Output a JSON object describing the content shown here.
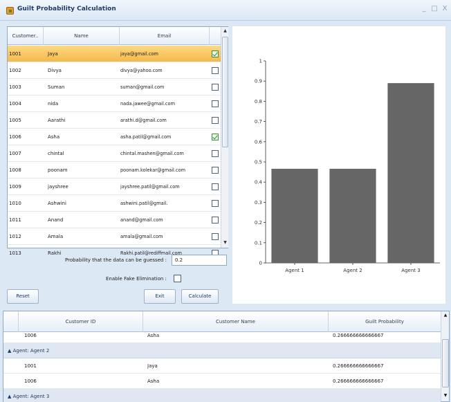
{
  "window": {
    "title": "Guilt Probability Calculation",
    "minimize": "_",
    "maximize": "□",
    "close": "X"
  },
  "grid": {
    "columns": [
      "Customer..",
      "Name",
      "Email"
    ],
    "rows": [
      {
        "id": "1001",
        "name": "Jaya",
        "email": "jaya@gmail.com",
        "checked": true,
        "selected": true
      },
      {
        "id": "1002",
        "name": "Divya",
        "email": "divya@yahoo.com",
        "checked": false
      },
      {
        "id": "1003",
        "name": "Suman",
        "email": "suman@gmail.com",
        "checked": false
      },
      {
        "id": "1004",
        "name": "nida",
        "email": "nada.jawee@gmail.com",
        "checked": false
      },
      {
        "id": "1005",
        "name": "Aarathi",
        "email": "arathi.d@gmail.com",
        "checked": false
      },
      {
        "id": "1006",
        "name": "Asha",
        "email": "asha.patil@gmail.com",
        "checked": true
      },
      {
        "id": "1007",
        "name": "chintal",
        "email": "chintal.mashen@gmail.com",
        "checked": false
      },
      {
        "id": "1008",
        "name": "poonam",
        "email": "poonam.kolekar@gmail.com",
        "checked": false
      },
      {
        "id": "1009",
        "name": "jayshree",
        "email": "jayshree.patil@gmail.com",
        "checked": false
      },
      {
        "id": "1010",
        "name": "Ashwini",
        "email": "ashwini.patil@gmail.",
        "checked": false
      },
      {
        "id": "1011",
        "name": "Anand",
        "email": "anand@gmail.com",
        "checked": false
      },
      {
        "id": "1012",
        "name": "Amala",
        "email": "amala@gmail.com",
        "checked": false
      },
      {
        "id": "1013",
        "name": "Rakhi",
        "email": "Rakhi.patil@rediffmail.com",
        "checked": false
      }
    ]
  },
  "options": {
    "probability_label": "Probability that the data can be guessed :",
    "probability_value": "0.2",
    "fake_label": "Enable Fake Elimination :"
  },
  "buttons": {
    "reset": "Reset",
    "exit": "Exit",
    "calculate": "Calculate"
  },
  "chart_data": {
    "type": "bar",
    "categories": [
      "Agent 1",
      "Agent 2",
      "Agent 3"
    ],
    "values": [
      0.466,
      0.466,
      0.89
    ],
    "ylim": [
      0,
      1
    ],
    "yticks": [
      "0",
      "0.1",
      "0.2",
      "0.3",
      "0.4",
      "0.5",
      "0.6",
      "0.7",
      "0.8",
      "0.9",
      "1"
    ],
    "bar_color": "#666666"
  },
  "results": {
    "columns": [
      "Customer ID",
      "Customer Name",
      "Guilt Probability"
    ],
    "partial_row": {
      "id": "1006",
      "name": "Asha",
      "prob": "0.266666666666667"
    },
    "groups": [
      {
        "label": "Agent: Agent 2",
        "rows": [
          {
            "id": "1001",
            "name": "Jaya",
            "prob": "0.266666666666667"
          },
          {
            "id": "1006",
            "name": "Asha",
            "prob": "0.266666666666667"
          }
        ]
      },
      {
        "label": "Agent: Agent 3",
        "rows": []
      }
    ]
  }
}
